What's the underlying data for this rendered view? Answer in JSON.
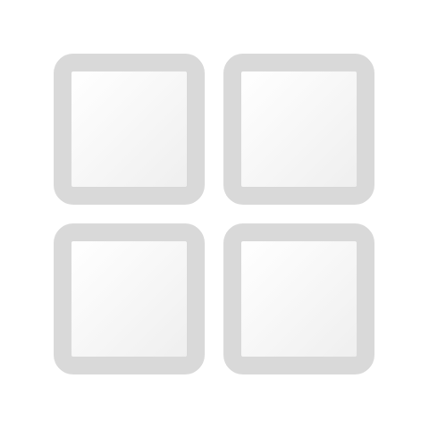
{
  "icon": {
    "semantic_name": "grid-view-icon",
    "tile_count": 4,
    "colors": {
      "background": "#ffffff",
      "tile_border": "#d9d9d9",
      "tile_fill_top": "#ffffff",
      "tile_fill_bottom": "#f0f0f0"
    }
  }
}
